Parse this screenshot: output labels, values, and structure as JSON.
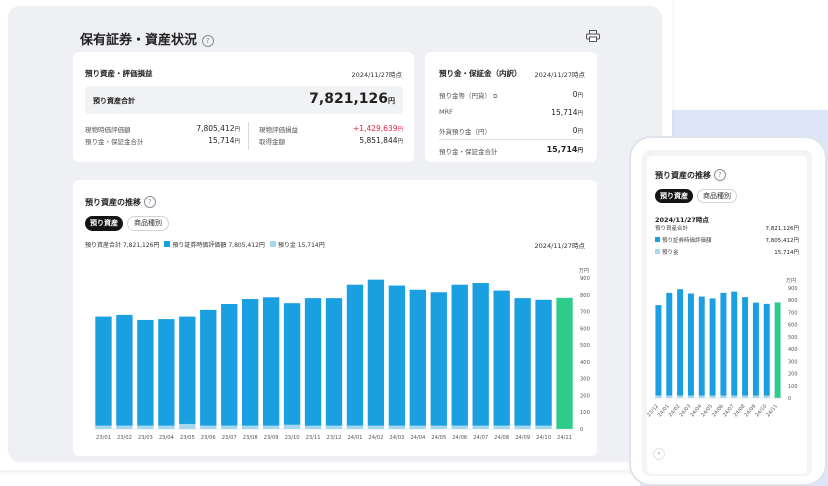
{
  "page": {
    "title": "保有証券・資産状況",
    "help": "?",
    "print_icon": "print-icon"
  },
  "assets_card": {
    "title": "預り資産・評価損益",
    "date": "2024/11/27時点",
    "total_label": "預り資産合計",
    "total_value": "7,821,126",
    "total_unit": "円",
    "rows_left": [
      {
        "label": "現物時価評価額",
        "value": "7,805,412",
        "unit": "円"
      },
      {
        "label": "預り金・保証金合計",
        "value": "15,714",
        "unit": "円"
      }
    ],
    "rows_right": [
      {
        "label": "現物評価損益",
        "value": "+1,429,639",
        "unit": "円",
        "color": "#e0244a"
      },
      {
        "label": "取得金額",
        "value": "5,851,844",
        "unit": "円",
        "color": "#222222"
      }
    ]
  },
  "deposit_card": {
    "title": "預り金・保証金（内訳）",
    "date": "2024/11/27時点",
    "rows": [
      {
        "label": "預り金等（円貨）",
        "value": "0",
        "unit": "円",
        "icon": "external-link-icon"
      },
      {
        "label": "MRF",
        "value": "15,714",
        "unit": "円"
      },
      {
        "label": "外貨預り金（円）",
        "value": "0",
        "unit": "円"
      }
    ],
    "total_label": "預り金・保証金合計",
    "total_value": "15,714",
    "total_unit": "円"
  },
  "trend_card": {
    "title": "預り資産の推移",
    "tabs": [
      "預り資産",
      "商品種別"
    ],
    "legend_total_label": "預り資産合計",
    "legend_total_value": "7,821,126円",
    "legend_securities_label": "預り証券時価評価額",
    "legend_securities_value": "7,805,412円",
    "legend_cash_label": "預り金",
    "legend_cash_value": "15,714円",
    "date": "2024/11/27時点",
    "unit": "万円"
  },
  "phone": {
    "title": "預り資産の推移",
    "tabs": [
      "預り資産",
      "商品種別"
    ],
    "date": "2024/11/27時点",
    "rows": [
      {
        "label": "預り資産合計",
        "value": "7,821,126円"
      },
      {
        "label": "預り証券時価評価額",
        "value": "7,805,412円"
      },
      {
        "label": "預り金",
        "value": "15,714円"
      }
    ],
    "unit": "万円",
    "scroll_button": "‹"
  },
  "colors": {
    "securities": "#1a9fe0",
    "cash": "#a8d8f0",
    "current": "#2ecc8a",
    "negative": "#e0244a"
  },
  "chart_data": [
    {
      "type": "bar",
      "categories": [
        "23/01",
        "23/02",
        "23/03",
        "23/04",
        "23/05",
        "23/06",
        "23/07",
        "23/08",
        "23/09",
        "23/10",
        "23/11",
        "23/12",
        "24/01",
        "24/02",
        "24/03",
        "24/04",
        "24/05",
        "24/06",
        "24/07",
        "24/08",
        "24/09",
        "24/10",
        "24/11"
      ],
      "series": [
        {
          "name": "預り証券時価評価額",
          "values": [
            650,
            660,
            630,
            635,
            640,
            690,
            725,
            755,
            765,
            725,
            760,
            760,
            840,
            870,
            835,
            810,
            795,
            840,
            850,
            805,
            760,
            750,
            780
          ]
        },
        {
          "name": "預り金",
          "values": [
            20,
            20,
            20,
            20,
            30,
            20,
            20,
            20,
            20,
            25,
            20,
            20,
            20,
            20,
            20,
            20,
            20,
            20,
            20,
            20,
            20,
            20,
            2
          ]
        }
      ],
      "ylim": [
        0,
        900
      ],
      "yticks": [
        0,
        100,
        200,
        300,
        400,
        500,
        600,
        700,
        800,
        900
      ],
      "ylabel": "万円"
    },
    {
      "type": "bar",
      "categories": [
        "23/12",
        "24/01",
        "24/02",
        "24/03",
        "24/04",
        "24/05",
        "24/06",
        "24/07",
        "24/08",
        "24/09",
        "24/10",
        "24/11"
      ],
      "series": [
        {
          "name": "預り証券時価評価額",
          "values": [
            740,
            840,
            870,
            835,
            810,
            795,
            840,
            850,
            805,
            760,
            750,
            780
          ]
        },
        {
          "name": "預り金",
          "values": [
            20,
            20,
            20,
            20,
            20,
            20,
            20,
            20,
            20,
            20,
            20,
            2
          ]
        }
      ],
      "ylim": [
        0,
        900
      ],
      "yticks": [
        0,
        100,
        200,
        300,
        400,
        500,
        600,
        700,
        800,
        900
      ],
      "ylabel": "万円"
    }
  ]
}
